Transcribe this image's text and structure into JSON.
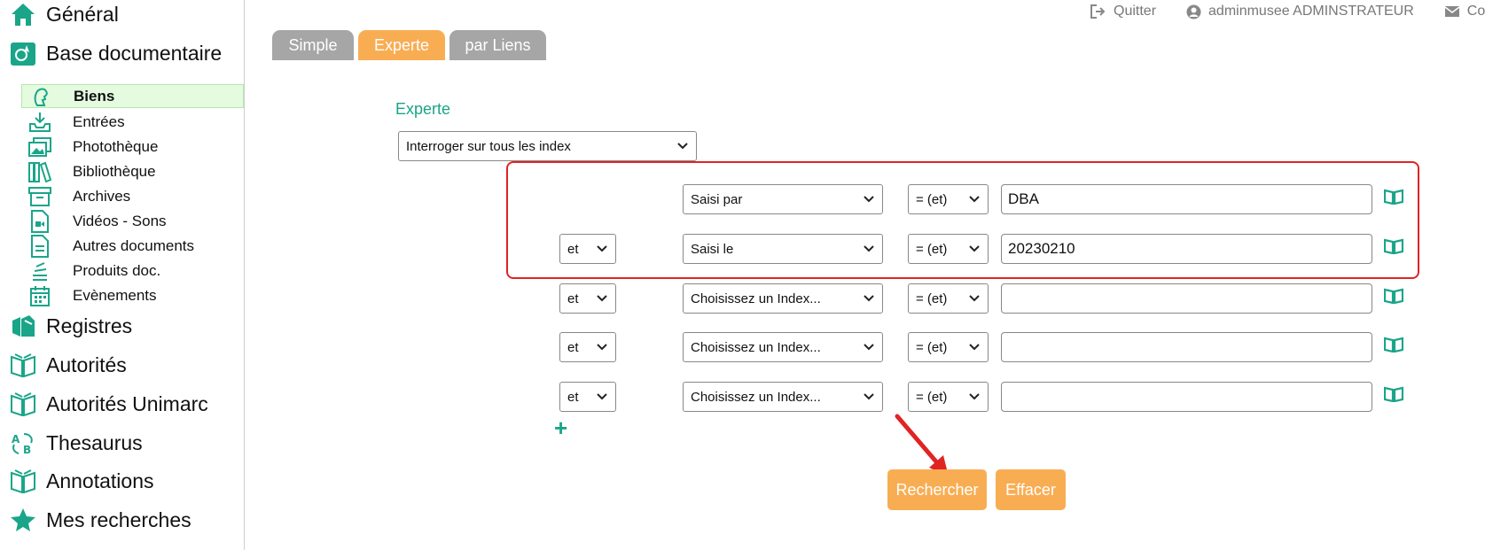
{
  "sidebar": {
    "top_items": [
      {
        "label": "Général",
        "icon": "home-icon"
      },
      {
        "label": "Base documentaire",
        "icon": "database-icon"
      }
    ],
    "sub_items": [
      {
        "label": "Biens",
        "icon": "bust-icon",
        "active": true
      },
      {
        "label": "Entrées",
        "icon": "inbox-download-icon"
      },
      {
        "label": "Photothèque",
        "icon": "photos-icon"
      },
      {
        "label": "Bibliothèque",
        "icon": "books-icon"
      },
      {
        "label": "Archives",
        "icon": "archive-box-icon"
      },
      {
        "label": "Vidéos - Sons",
        "icon": "video-file-icon"
      },
      {
        "label": "Autres documents",
        "icon": "document-icon"
      },
      {
        "label": "Produits doc.",
        "icon": "stack-icon"
      },
      {
        "label": "Evènements",
        "icon": "calendar-icon"
      }
    ],
    "bottom_items": [
      {
        "label": "Registres",
        "icon": "registers-icon"
      },
      {
        "label": "Autorités",
        "icon": "open-book-icon"
      },
      {
        "label": "Autorités Unimarc",
        "icon": "open-book-icon"
      },
      {
        "label": "Thesaurus",
        "icon": "thesaurus-icon"
      },
      {
        "label": "Annotations",
        "icon": "open-book-icon"
      },
      {
        "label": "Mes recherches",
        "icon": "star-icon"
      }
    ]
  },
  "topbar": {
    "quit_label": "Quitter",
    "user_label": "adminmusee ADMINSTRATEUR",
    "contact_label": "Co"
  },
  "tabs": [
    {
      "label": "Simple",
      "active": false
    },
    {
      "label": "Experte",
      "active": true
    },
    {
      "label": "par Liens",
      "active": false
    }
  ],
  "form": {
    "section_title": "Experte",
    "scope_select": "Interroger sur tous les index",
    "rows": [
      {
        "logic": "",
        "index": "Saisi par",
        "operator": "= (et)",
        "value": "DBA"
      },
      {
        "logic": "et",
        "index": "Saisi le",
        "operator": "= (et)",
        "value": "20230210"
      },
      {
        "logic": "et",
        "index": "Choisissez un Index...",
        "operator": "= (et)",
        "value": ""
      },
      {
        "logic": "et",
        "index": "Choisissez un Index...",
        "operator": "= (et)",
        "value": ""
      },
      {
        "logic": "et",
        "index": "Choisissez un Index...",
        "operator": "= (et)",
        "value": ""
      }
    ],
    "add_row_label": "+",
    "search_label": "Rechercher",
    "clear_label": "Effacer"
  },
  "colors": {
    "accent_green": "#1aa589",
    "accent_orange": "#f9ad53",
    "tab_grey": "#a6a6a6",
    "highlight_red": "#e02424"
  }
}
